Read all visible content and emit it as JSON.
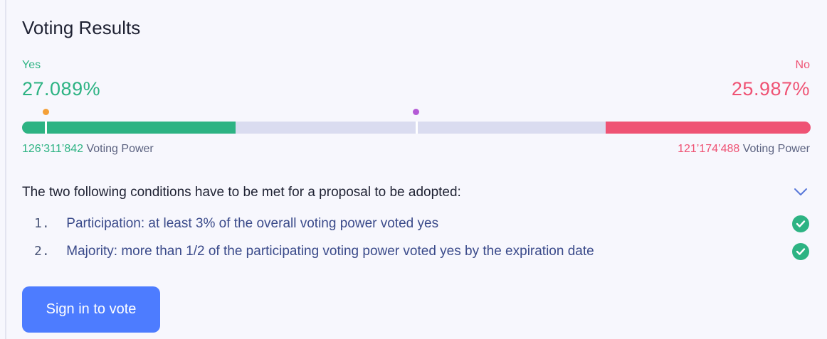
{
  "header": {
    "title": "Voting Results"
  },
  "results": {
    "yes_label": "Yes",
    "no_label": "No",
    "yes_percent_text": "27.089%",
    "no_percent_text": "25.987%",
    "yes_percent": 27.089,
    "no_percent": 25.987,
    "threshold_percent": 3,
    "majority_percent": 50,
    "yes_voting_power": "126’311’842",
    "no_voting_power": "121’174’488",
    "voting_power_label": "Voting Power",
    "colors": {
      "yes": "#2db383",
      "no": "#ef5374",
      "threshold_marker": "#f4a038",
      "majority_marker": "#b45ad6"
    }
  },
  "conditions": {
    "heading": "The two following conditions have to be met for a proposal to be adopted:",
    "toggle_icon": "chevron-down-icon",
    "items": [
      {
        "number": "1.",
        "text": "Participation: at least 3% of the overall voting power voted yes",
        "status_icon": "check-circle-icon"
      },
      {
        "number": "2.",
        "text": "Majority: more than 1/2 of the participating voting power voted yes by the expiration date",
        "status_icon": "check-circle-icon"
      }
    ]
  },
  "actions": {
    "sign_in_label": "Sign in to vote",
    "accent": "#4d7cff"
  }
}
